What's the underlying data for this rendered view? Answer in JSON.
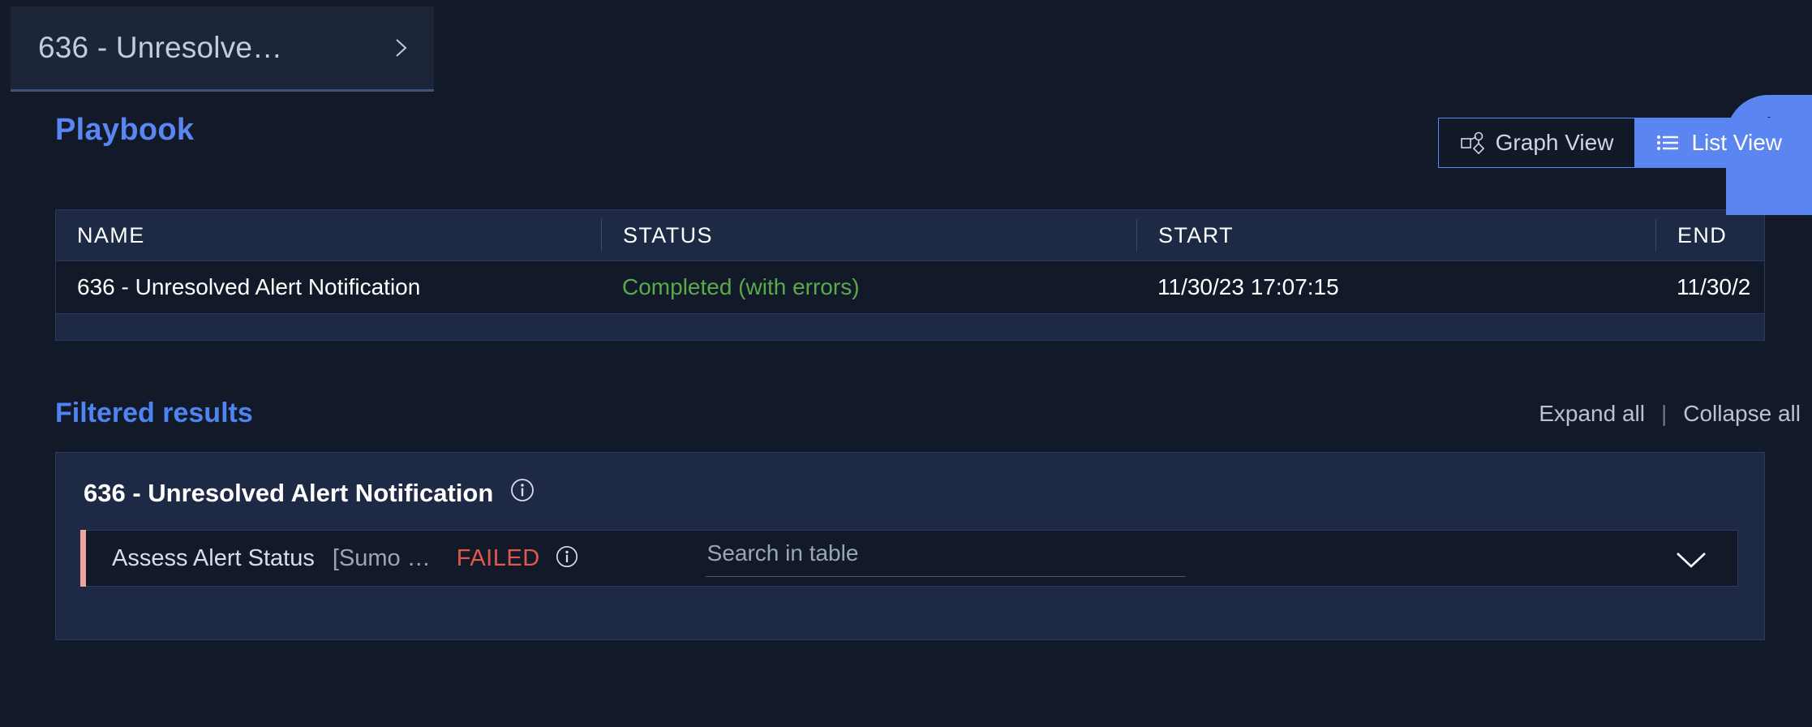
{
  "tab": {
    "label": "636 - Unresolve…",
    "chevron_icon": "chevron-right-icon"
  },
  "header": {
    "title": "Playbook",
    "view_toggle": {
      "graph_view_label": "Graph View",
      "graph_view_icon": "graph-nodes-icon",
      "list_view_label": "List View",
      "list_view_icon": "bulleted-list-icon",
      "selected": "List View"
    },
    "timer_badge_icon": "stopwatch-icon"
  },
  "summary_table": {
    "columns": [
      "NAME",
      "STATUS",
      "START",
      "END"
    ],
    "rows": [
      {
        "name": "636 - Unresolved Alert Notification",
        "status": "Completed (with errors)",
        "start": "11/30/23 17:07:15",
        "end": "11/30/2"
      }
    ]
  },
  "filtered_results": {
    "title": "Filtered results",
    "expand_all_label": "Expand all",
    "separator": "|",
    "collapse_all_label": "Collapse all",
    "cards": [
      {
        "title": "636 - Unresolved Alert Notification",
        "info_icon": "info-circle-icon",
        "task": {
          "name": "Assess Alert Status",
          "integration": "[Sumo …",
          "status": "FAILED",
          "info_icon": "info-circle-icon",
          "search_placeholder": "Search in table",
          "search_value": "",
          "expand_icon": "chevron-down-icon"
        }
      }
    ]
  },
  "colors": {
    "accent_blue": "#5b86f2",
    "status_success": "#5aa94a",
    "status_failed": "#e3584b",
    "failed_bar": "#eda59c",
    "page_bg": "#121a2a",
    "card_bg": "#1e2a45"
  }
}
